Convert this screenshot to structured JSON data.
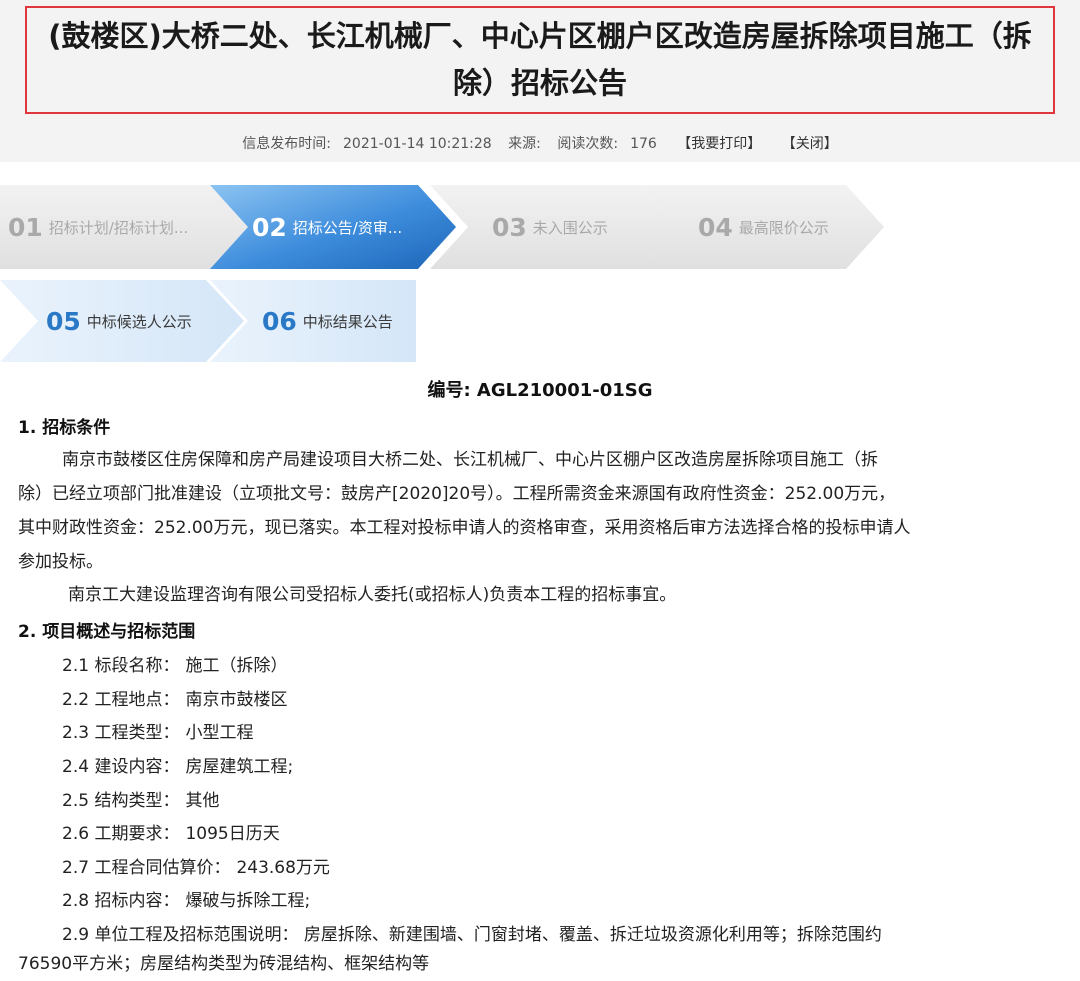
{
  "page": {
    "title": "(鼓楼区)大桥二处、长江机械厂、中心片区棚户区改造房屋拆除项目施工（拆除）招标公告"
  },
  "meta": {
    "publish_label": "信息发布时间:",
    "publish_time": "2021-01-14 10:21:28",
    "source_label": "来源:",
    "reads_label": "阅读次数:",
    "reads": "176",
    "print_btn": "【我要打印】",
    "close_btn": "【关闭】"
  },
  "steps": [
    {
      "num": "01",
      "label": "招标计划/招标计划...",
      "state": "grey"
    },
    {
      "num": "02",
      "label": "招标公告/资审...",
      "state": "active"
    },
    {
      "num": "03",
      "label": "未入围公示",
      "state": "grey"
    },
    {
      "num": "04",
      "label": "最高限价公示",
      "state": "grey"
    },
    {
      "num": "05",
      "label": "中标候选人公示",
      "state": "light"
    },
    {
      "num": "06",
      "label": "中标结果公告",
      "state": "light"
    }
  ],
  "doc": {
    "code": "编号: AGL210001-01SG",
    "section1_title": "1. 招标条件",
    "section1_para1_l1": "南京市鼓楼区住房保障和房产局建设项目大桥二处、长江机械厂、中心片区棚户区改造房屋拆除项目施工（拆",
    "section1_para1_l2": "除）已经立项部门批准建设（立项批文号：鼓房产[2020]20号）。工程所需资金来源国有政府性资金：252.00万元，",
    "section1_para1_l3": "其中财政性资金：252.00万元，现已落实。本工程对投标申请人的资格审查，采用资格后审方法选择合格的投标申请人",
    "section1_para1_l4": "参加投标。",
    "section1_para2": "南京工大建设监理咨询有限公司受招标人委托(或招标人)负责本工程的招标事宜。",
    "section2_title": "2. 项目概述与招标范围",
    "items": [
      {
        "k": "2.1 标段名称：",
        "v": "施工（拆除）"
      },
      {
        "k": "2.2 工程地点：",
        "v": "南京市鼓楼区"
      },
      {
        "k": "2.3 工程类型：",
        "v": "小型工程"
      },
      {
        "k": "2.4 建设内容：",
        "v": "房屋建筑工程;"
      },
      {
        "k": "2.5 结构类型：",
        "v": "其他"
      },
      {
        "k": "2.6 工期要求：",
        "v": "1095日历天"
      },
      {
        "k": "2.7 工程合同估算价：",
        "v": "243.68万元"
      },
      {
        "k": "2.8 招标内容：",
        "v": "爆破与拆除工程;"
      }
    ],
    "item29_l1": "2.9 单位工程及招标范围说明：  房屋拆除、新建围墙、门窗封堵、覆盖、拆迁垃圾资源化利用等；拆除范围约",
    "item29_l2": "76590平方米；房屋结构类型为砖混结构、框架结构等"
  },
  "colors": {
    "title_border": "#e0363c",
    "step_active": "#2a78c8",
    "step_grey": "#eaeaea",
    "step_light": "#ddebf9"
  }
}
